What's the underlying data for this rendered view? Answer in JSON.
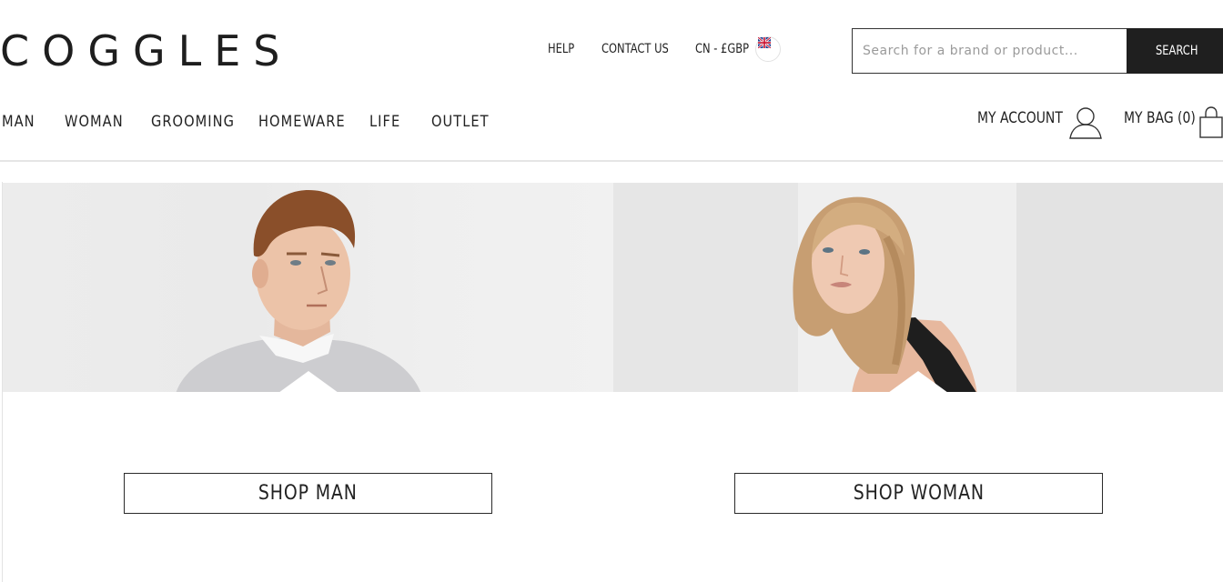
{
  "brand": {
    "logo_text": "COGGLES"
  },
  "utility_nav": {
    "help": "HELP",
    "contact": "CONTACT US",
    "currency": "CN - £GBP"
  },
  "search": {
    "placeholder": "Search for a brand or product...",
    "button_label": "SEARCH"
  },
  "main_nav": {
    "items": [
      {
        "label": "MAN"
      },
      {
        "label": "WOMAN"
      },
      {
        "label": "GROOMING"
      },
      {
        "label": "HOMEWARE"
      },
      {
        "label": "LIFE"
      },
      {
        "label": "OUTLET"
      }
    ]
  },
  "account": {
    "my_account_label": "MY ACCOUNT",
    "bag_label": "MY BAG (0)"
  },
  "promos": [
    {
      "cta": "SHOP MAN"
    },
    {
      "cta": "SHOP WOMAN"
    }
  ],
  "colors": {
    "text": "#222222",
    "search_button_bg": "#1f1f1f",
    "divider": "#e5e5e5"
  }
}
